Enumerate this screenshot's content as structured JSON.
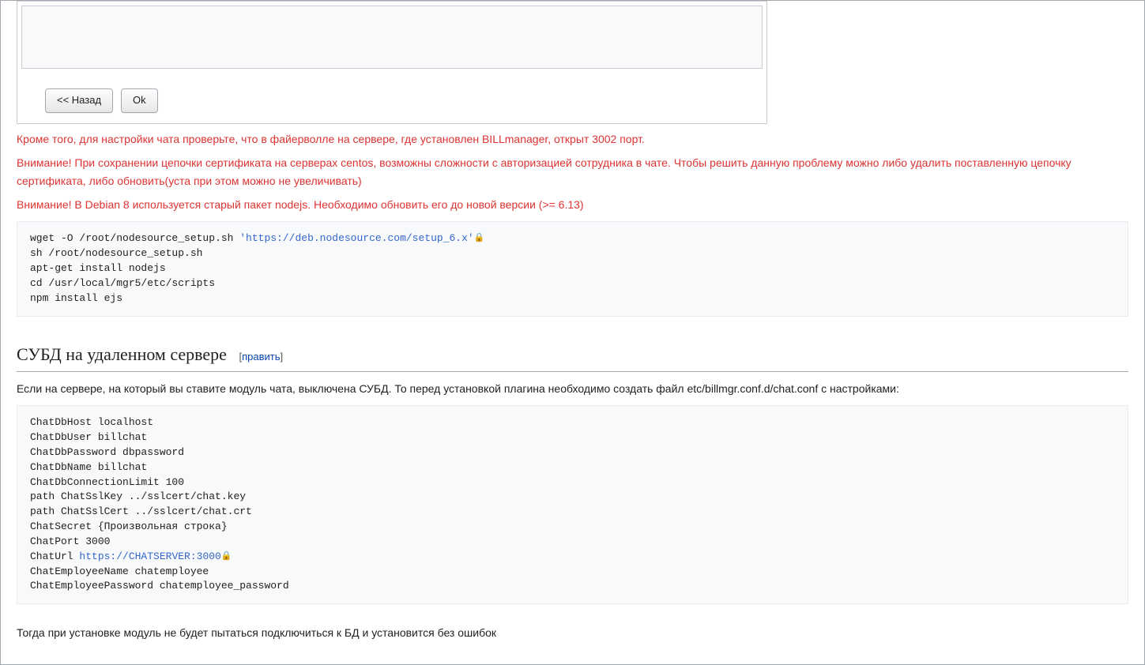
{
  "buttons": {
    "back": "<< Назад",
    "ok": "Ok"
  },
  "warnings": {
    "firewall": "Кроме того, для настройки чата проверьте, что в файерволле на сервере, где установлен BILLmanager, открыт 3002 порт.",
    "centos": "Внимание! При сохранении цепочки сертификата на серверах centos, возможны сложности с авторизацией сотрудника в чате. Чтобы решить данную проблему можно либо удалить поставленную цепочку сертификата, либо обновить(уста при этом можно не увеличивать)",
    "debian": "Внимание! В Debian 8 используется старый пакет nodejs. Необходимо обновить его до новой версии (>= 6.13)"
  },
  "code1": {
    "prefix": "wget -O /root/nodesource_setup.sh ",
    "url": "'https://deb.nodesource.com/setup_6.x'",
    "rest": "sh /root/nodesource_setup.sh\napt-get install nodejs\ncd /usr/local/mgr5/etc/scripts\nnpm install ejs"
  },
  "section": {
    "title": "СУБД на удаленном сервере",
    "editlabel": "править"
  },
  "intro2": "Если на сервере, на который вы ставите модуль чата, выключена СУБД. То перед установкой плагина необходимо создать файл etc/billmgr.conf.d/chat.conf с настройками:",
  "code2": {
    "part1": "ChatDbHost localhost\nChatDbUser billchat\nChatDbPassword dbpassword\nChatDbName billchat\nChatDbConnectionLimit 100\npath ChatSslKey ../sslcert/chat.key\npath ChatSslCert ../sslcert/chat.crt\nChatSecret {Произвольная строка}\nChatPort 3000\nChatUrl ",
    "url": "https://CHATSERVER:3000",
    "part2": "\nChatEmployeeName chatemployee\nChatEmployeePassword chatemployee_password"
  },
  "outro": "Тогда при установке модуль не будет пытаться подключиться к БД и установится без ошибок"
}
